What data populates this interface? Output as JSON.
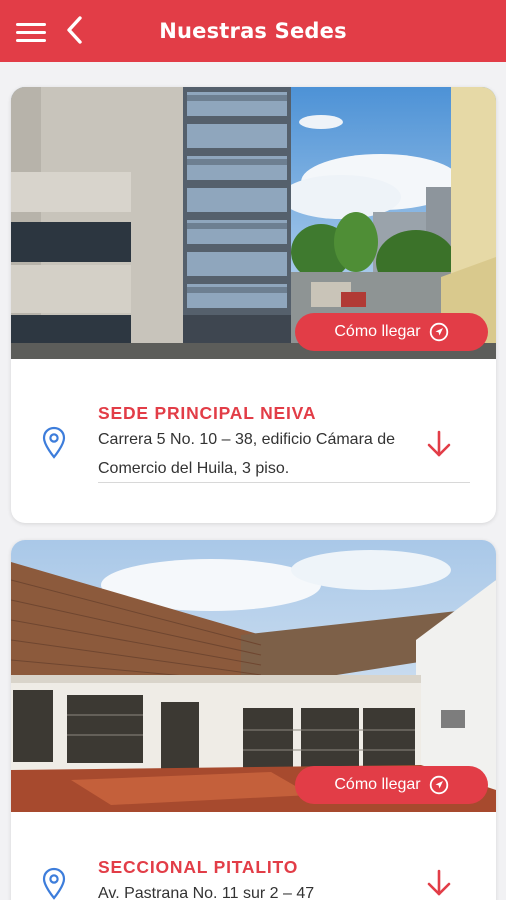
{
  "header": {
    "title": "Nuestras Sedes",
    "menu_icon": "hamburger-menu-icon",
    "back_icon": "chevron-left-icon"
  },
  "colors": {
    "brand": "#e23d47",
    "background": "#f2f2f4",
    "card": "#ffffff",
    "pin": "#3d7ddb"
  },
  "sedes": [
    {
      "name": "SEDE PRINCIPAL NEIVA",
      "address": "Carrera 5 No. 10 – 38, edificio Cámara de Comercio del Huila, 3 piso.",
      "route_label": "Cómo llegar"
    },
    {
      "name": "SECCIONAL PITALITO",
      "address": "Av. Pastrana No. 11 sur 2 – 47",
      "route_label": "Cómo llegar"
    }
  ]
}
